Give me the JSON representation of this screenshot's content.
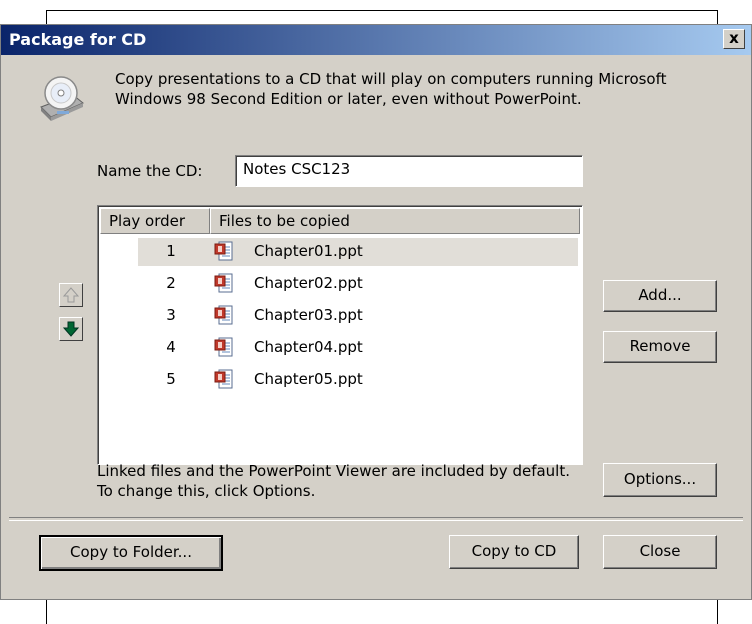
{
  "dialog": {
    "title": "Package for CD",
    "close_glyph": "x",
    "description": "Copy presentations to a CD that will play on computers running Microsoft Windows 98 Second Edition or later, even without PowerPoint.",
    "name_label": "Name the CD:",
    "name_value": "Notes CSC123",
    "list": {
      "columns": [
        "Play order",
        "Files to be copied"
      ],
      "rows": [
        {
          "order": "1",
          "file": "Chapter01.ppt"
        },
        {
          "order": "2",
          "file": "Chapter02.ppt"
        },
        {
          "order": "3",
          "file": "Chapter03.ppt"
        },
        {
          "order": "4",
          "file": "Chapter04.ppt"
        },
        {
          "order": "5",
          "file": "Chapter05.ppt"
        }
      ],
      "selected_index": 0
    },
    "buttons": {
      "add": "Add...",
      "remove": "Remove",
      "options": "Options...",
      "copy_to_folder": "Copy to Folder...",
      "copy_to_cd": "Copy to CD",
      "close": "Close"
    },
    "linked_note": "Linked files and the PowerPoint Viewer are included by default. To change this, click Options.",
    "icons": {
      "cd": "cd-drive-icon",
      "move_up": "arrow-up-icon",
      "move_down": "arrow-down-icon",
      "file": "powerpoint-file-icon"
    },
    "colors": {
      "title_gradient_start": "#0a246a",
      "title_gradient_end": "#a6caf0",
      "face": "#d4d0c8",
      "down_arrow": "#006633"
    }
  }
}
